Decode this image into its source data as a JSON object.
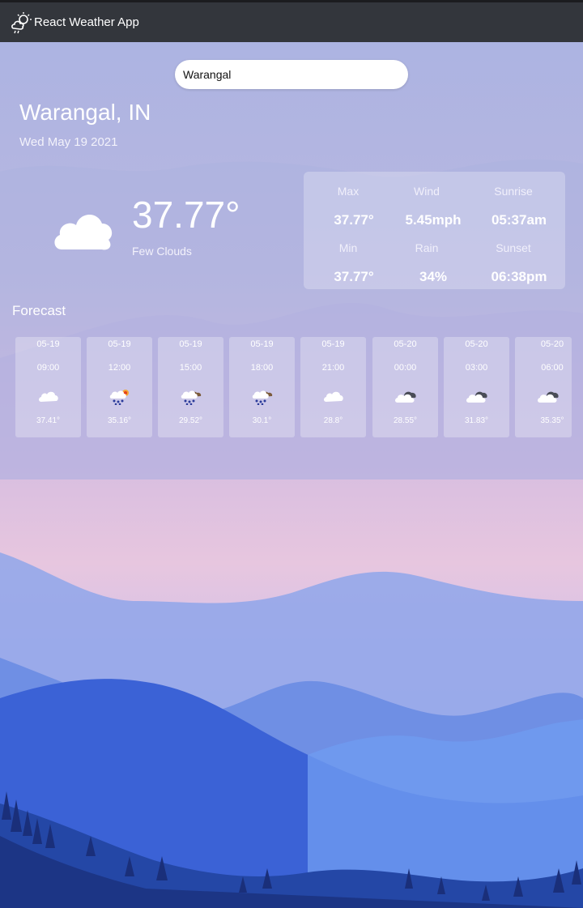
{
  "app": {
    "title": "React Weather App",
    "logo_icon": "weather-logo-icon"
  },
  "search": {
    "value": "Warangal"
  },
  "location": {
    "city": "Warangal, IN",
    "date": "Wed May 19 2021"
  },
  "current": {
    "temp": "37.77°",
    "description": "Few Clouds",
    "icon": "few-clouds-icon"
  },
  "stats": [
    {
      "label": "Max",
      "value": "37.77°"
    },
    {
      "label": "Wind",
      "value": "5.45mph"
    },
    {
      "label": "Sunrise",
      "value": "05:37am"
    },
    {
      "label": "Min",
      "value": "37.77°"
    },
    {
      "label": "Rain",
      "value": "34%"
    },
    {
      "label": "Sunset",
      "value": "06:38pm"
    }
  ],
  "forecast": {
    "title": "Forecast",
    "items": [
      {
        "date": "05-19",
        "time": "09:00",
        "temp": "37.41°",
        "icon": "cloud-icon"
      },
      {
        "date": "05-19",
        "time": "12:00",
        "temp": "35.16°",
        "icon": "rain-sun-icon"
      },
      {
        "date": "05-19",
        "time": "15:00",
        "temp": "29.52°",
        "icon": "rain-cloud-icon"
      },
      {
        "date": "05-19",
        "time": "18:00",
        "temp": "30.1°",
        "icon": "rain-cloud-icon"
      },
      {
        "date": "05-19",
        "time": "21:00",
        "temp": "28.8°",
        "icon": "cloud-icon"
      },
      {
        "date": "05-20",
        "time": "00:00",
        "temp": "28.55°",
        "icon": "broken-clouds-icon"
      },
      {
        "date": "05-20",
        "time": "03:00",
        "temp": "31.83°",
        "icon": "broken-clouds-icon"
      },
      {
        "date": "05-20",
        "time": "06:00",
        "temp": "35.35°",
        "icon": "broken-clouds-icon"
      }
    ]
  },
  "colors": {
    "topbar": "#33363c",
    "accent": "#2f5fd6"
  }
}
